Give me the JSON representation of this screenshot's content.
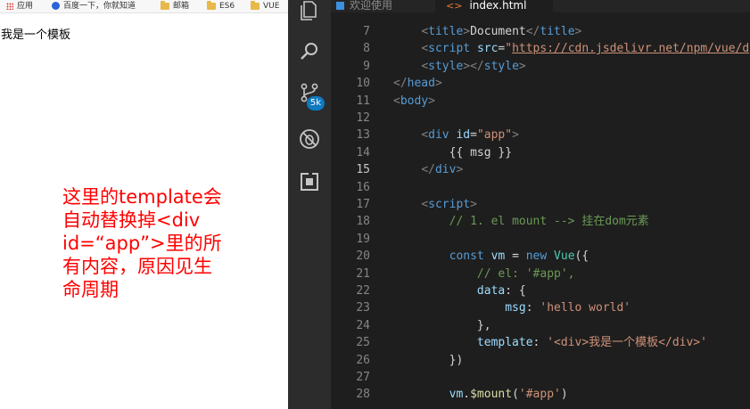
{
  "browser": {
    "bookmarks": [
      {
        "label": "应用",
        "icon": "apps-grid-icon"
      },
      {
        "label": "百度一下，你就知道",
        "icon": "baidu-paw-icon"
      },
      {
        "label": "邮箱",
        "icon": "folder-icon"
      },
      {
        "label": "ES6",
        "icon": "folder-icon"
      },
      {
        "label": "VUE",
        "icon": "folder-icon"
      }
    ],
    "page_text": "我是一个模板"
  },
  "note": {
    "lines": [
      "这里的template会",
      "自动替换掉<div",
      "id=“app”>里的所",
      "有内容，原因见生",
      "命周期"
    ],
    "color": "#ff0000"
  },
  "editor": {
    "tabs": [
      {
        "label": "欢迎使用",
        "active": false
      },
      {
        "label": "index.html",
        "active": true
      }
    ],
    "activity_icons": [
      "files-icon",
      "search-icon",
      "source-control-icon",
      "debug-icon",
      "extensions-icon"
    ],
    "scm_badge": "5k",
    "current_line": 15,
    "lines": [
      {
        "n": 7,
        "tokens": [
          [
            "",
            "    "
          ],
          [
            "br",
            "<"
          ],
          [
            "tag",
            "title"
          ],
          [
            "br",
            ">"
          ],
          [
            "txt",
            "Document"
          ],
          [
            "br",
            "</"
          ],
          [
            "tag",
            "title"
          ],
          [
            "br",
            ">"
          ]
        ]
      },
      {
        "n": 8,
        "tokens": [
          [
            "",
            "    "
          ],
          [
            "br",
            "<"
          ],
          [
            "tag",
            "script"
          ],
          [
            "",
            " "
          ],
          [
            "attr",
            "src"
          ],
          [
            "txt",
            "="
          ],
          [
            "str",
            "\""
          ],
          [
            "url",
            "https://cdn.jsdelivr.net/npm/vue/d"
          ]
        ]
      },
      {
        "n": 9,
        "tokens": [
          [
            "",
            "    "
          ],
          [
            "br",
            "<"
          ],
          [
            "tag",
            "style"
          ],
          [
            "br",
            "></"
          ],
          [
            "tag",
            "style"
          ],
          [
            "br",
            ">"
          ]
        ]
      },
      {
        "n": 10,
        "tokens": [
          [
            "br",
            "</"
          ],
          [
            "tag",
            "head"
          ],
          [
            "br",
            ">"
          ]
        ]
      },
      {
        "n": 11,
        "tokens": [
          [
            "br",
            "<"
          ],
          [
            "tag",
            "body"
          ],
          [
            "br",
            ">"
          ]
        ]
      },
      {
        "n": 12,
        "tokens": []
      },
      {
        "n": 13,
        "tokens": [
          [
            "",
            "    "
          ],
          [
            "br",
            "<"
          ],
          [
            "tag",
            "div"
          ],
          [
            "",
            " "
          ],
          [
            "attr",
            "id"
          ],
          [
            "txt",
            "="
          ],
          [
            "str",
            "\"app\""
          ],
          [
            "br",
            ">"
          ]
        ]
      },
      {
        "n": 14,
        "tokens": [
          [
            "",
            "        "
          ],
          [
            "txt",
            "{{ msg }}"
          ]
        ]
      },
      {
        "n": 15,
        "tokens": [
          [
            "",
            "    "
          ],
          [
            "br",
            "</"
          ],
          [
            "tag",
            "div"
          ],
          [
            "br",
            ">"
          ]
        ]
      },
      {
        "n": 16,
        "tokens": []
      },
      {
        "n": 17,
        "tokens": [
          [
            "",
            "    "
          ],
          [
            "br",
            "<"
          ],
          [
            "tag",
            "script"
          ],
          [
            "br",
            ">"
          ]
        ]
      },
      {
        "n": 18,
        "tokens": [
          [
            "",
            "        "
          ],
          [
            "com",
            "// 1. el mount --> 挂在dom元素"
          ]
        ]
      },
      {
        "n": 19,
        "tokens": []
      },
      {
        "n": 20,
        "tokens": [
          [
            "",
            "        "
          ],
          [
            "kw",
            "const"
          ],
          [
            "",
            " "
          ],
          [
            "var",
            "vm"
          ],
          [
            "txt",
            " = "
          ],
          [
            "kw",
            "new"
          ],
          [
            "",
            " "
          ],
          [
            "cls",
            "Vue"
          ],
          [
            "txt",
            "({"
          ]
        ]
      },
      {
        "n": 21,
        "tokens": [
          [
            "",
            "            "
          ],
          [
            "com",
            "// el: '#app',"
          ]
        ]
      },
      {
        "n": 22,
        "tokens": [
          [
            "",
            "            "
          ],
          [
            "var",
            "data"
          ],
          [
            "txt",
            ": {"
          ]
        ]
      },
      {
        "n": 23,
        "tokens": [
          [
            "",
            "                "
          ],
          [
            "var",
            "msg"
          ],
          [
            "txt",
            ": "
          ],
          [
            "str",
            "'hello world'"
          ]
        ]
      },
      {
        "n": 24,
        "tokens": [
          [
            "",
            "            "
          ],
          [
            "txt",
            "},"
          ]
        ]
      },
      {
        "n": 25,
        "tokens": [
          [
            "",
            "            "
          ],
          [
            "var",
            "template"
          ],
          [
            "txt",
            ": "
          ],
          [
            "str",
            "'<div>我是一个模板</div>'"
          ]
        ]
      },
      {
        "n": 26,
        "tokens": [
          [
            "",
            "        "
          ],
          [
            "txt",
            "})"
          ]
        ]
      },
      {
        "n": 27,
        "tokens": []
      },
      {
        "n": 28,
        "tokens": [
          [
            "",
            "        "
          ],
          [
            "var",
            "vm"
          ],
          [
            "txt",
            "."
          ],
          [
            "fn",
            "$mount"
          ],
          [
            "txt",
            "("
          ],
          [
            "str",
            "'#app'"
          ],
          [
            "txt",
            ")"
          ]
        ]
      }
    ]
  }
}
